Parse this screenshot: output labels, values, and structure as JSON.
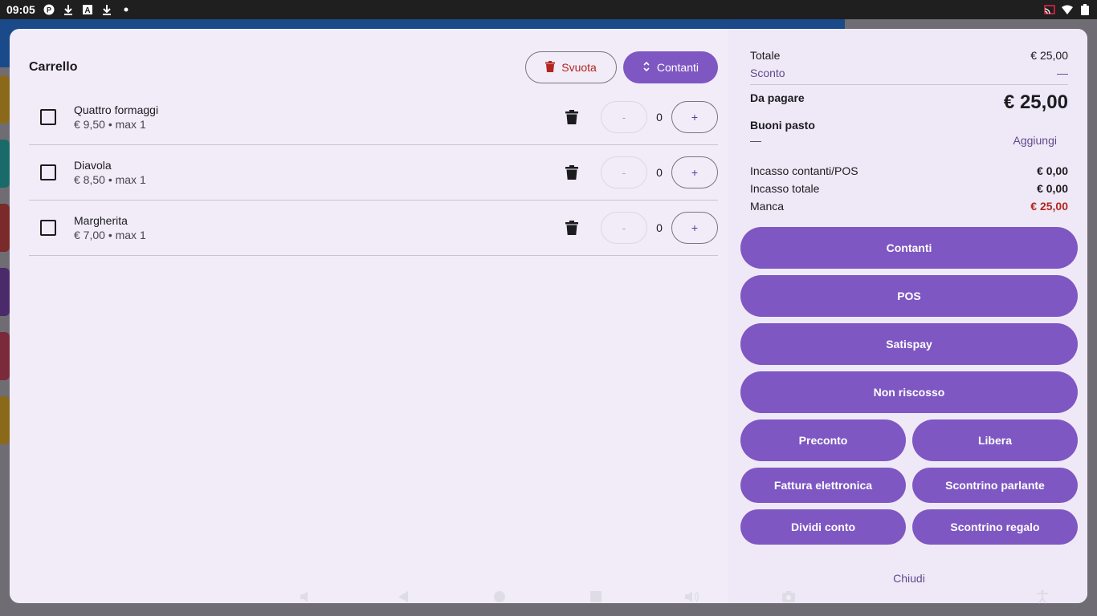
{
  "status_bar": {
    "time": "09:05"
  },
  "cart": {
    "title": "Carrello",
    "clear_label": "Svuota",
    "mode_label": "Contanti",
    "items": [
      {
        "name": "Quattro formaggi",
        "sub": "€ 9,50 • max 1",
        "qty": "0",
        "minus": "-",
        "plus": "+"
      },
      {
        "name": "Diavola",
        "sub": "€ 8,50 • max 1",
        "qty": "0",
        "minus": "-",
        "plus": "+"
      },
      {
        "name": "Margherita",
        "sub": "€ 7,00 • max 1",
        "qty": "0",
        "minus": "-",
        "plus": "+"
      }
    ]
  },
  "summary": {
    "totale_label": "Totale",
    "totale_value": "€ 25,00",
    "sconto_label": "Sconto",
    "sconto_value": "—",
    "da_pagare_label": "Da pagare",
    "da_pagare_value": "€ 25,00",
    "buoni_label": "Buoni pasto",
    "buoni_value": "—",
    "aggiungi_label": "Aggiungi",
    "incasso_cp_label": "Incasso contanti/POS",
    "incasso_cp_value": "€ 0,00",
    "incasso_tot_label": "Incasso totale",
    "incasso_tot_value": "€ 0,00",
    "manca_label": "Manca",
    "manca_value": "€ 25,00"
  },
  "actions": {
    "contanti": "Contanti",
    "pos": "POS",
    "satispay": "Satispay",
    "non_riscosso": "Non riscosso",
    "preconto": "Preconto",
    "libera": "Libera",
    "fattura": "Fattura elettronica",
    "scontrino_parlante": "Scontrino parlante",
    "dividi": "Dividi conto",
    "scontrino_regalo": "Scontrino regalo",
    "chiudi": "Chiudi"
  },
  "colors": {
    "accent": "#7e57c2",
    "danger": "#b3261e",
    "surface": "#f1ecf8"
  }
}
